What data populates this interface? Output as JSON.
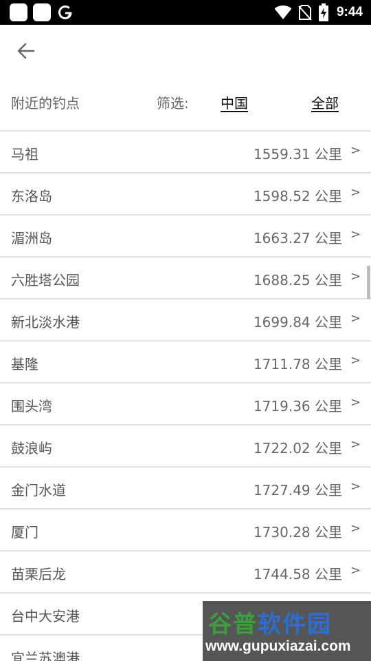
{
  "status_bar": {
    "time": "9:44",
    "icons": [
      "app-square-icon",
      "app-square-icon",
      "google-icon",
      "wifi-icon",
      "no-sim-icon",
      "battery-charging-icon"
    ]
  },
  "toolbar": {
    "back_icon": "arrow-left-icon"
  },
  "filter": {
    "nearby_label": "附近的钓点",
    "filter_label": "筛选:",
    "option_china": "中国",
    "option_all": "全部"
  },
  "spots": [
    {
      "name": "马祖",
      "distance": "1559.31 公里",
      "chevron": ">"
    },
    {
      "name": "东洛岛",
      "distance": "1598.52 公里",
      "chevron": ">"
    },
    {
      "name": "湄洲岛",
      "distance": "1663.27 公里",
      "chevron": ">"
    },
    {
      "name": "六胜塔公园",
      "distance": "1688.25 公里",
      "chevron": ">"
    },
    {
      "name": "新北淡水港",
      "distance": "1699.84 公里",
      "chevron": ">"
    },
    {
      "name": "基隆",
      "distance": "1711.78 公里",
      "chevron": ">"
    },
    {
      "name": "围头湾",
      "distance": "1719.36 公里",
      "chevron": ">"
    },
    {
      "name": "鼓浪屿",
      "distance": "1722.02 公里",
      "chevron": ">"
    },
    {
      "name": "金门水道",
      "distance": "1727.49 公里",
      "chevron": ">"
    },
    {
      "name": "厦门",
      "distance": "1730.28 公里",
      "chevron": ">"
    },
    {
      "name": "苗栗后龙",
      "distance": "1744.58 公里",
      "chevron": ">"
    },
    {
      "name": "台中大安港",
      "distance": "",
      "chevron": ""
    },
    {
      "name": "宜兰苏澳港",
      "distance": "",
      "chevron": ""
    }
  ],
  "watermark": {
    "title_part1": "谷普",
    "title_part2": "软件园",
    "url": "www.gupuxiazai.com"
  }
}
